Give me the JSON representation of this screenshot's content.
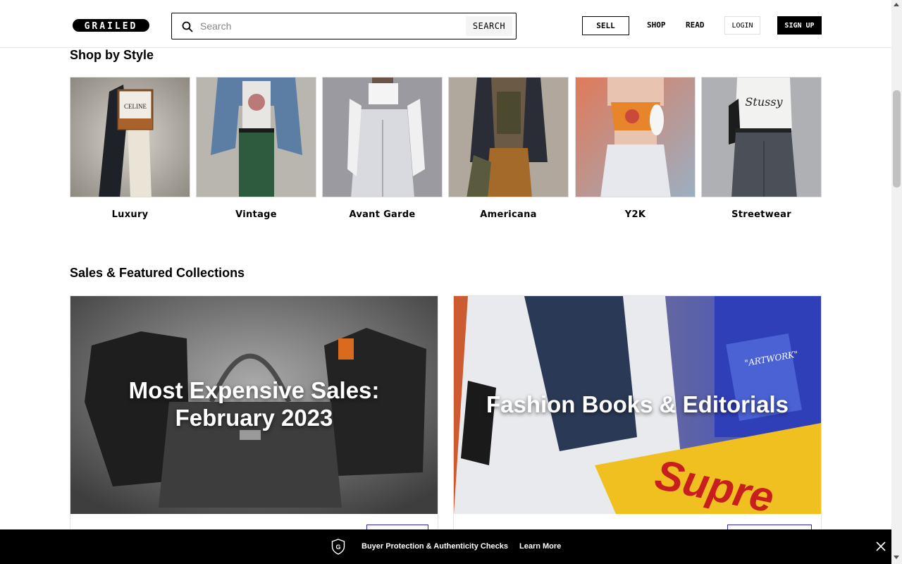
{
  "header": {
    "logo_text": "GRAILED",
    "search": {
      "placeholder": "Search",
      "button_label": "SEARCH"
    },
    "sell_label": "SELL",
    "shop_label": "SHOP",
    "read_label": "READ",
    "login_label": "LOGIN",
    "signup_label": "SIGN UP"
  },
  "shop_by_style": {
    "title": "Shop by Style",
    "items": [
      {
        "label": "Luxury"
      },
      {
        "label": "Vintage"
      },
      {
        "label": "Avant Garde"
      },
      {
        "label": "Americana"
      },
      {
        "label": "Y2K"
      },
      {
        "label": "Streetwear"
      }
    ]
  },
  "collections": {
    "title": "Sales & Featured Collections",
    "items": [
      {
        "title_line1": "Most Expensive Sales:",
        "title_line2": "February 2023"
      },
      {
        "title_line1": "Fashion Books & Editorials"
      }
    ]
  },
  "banner": {
    "icon_letter": "G",
    "text": "Buyer Protection & Authenticity Checks",
    "link": "Learn More"
  },
  "colors": {
    "accent": "#2a2acb",
    "banner_bg": "#000000"
  }
}
